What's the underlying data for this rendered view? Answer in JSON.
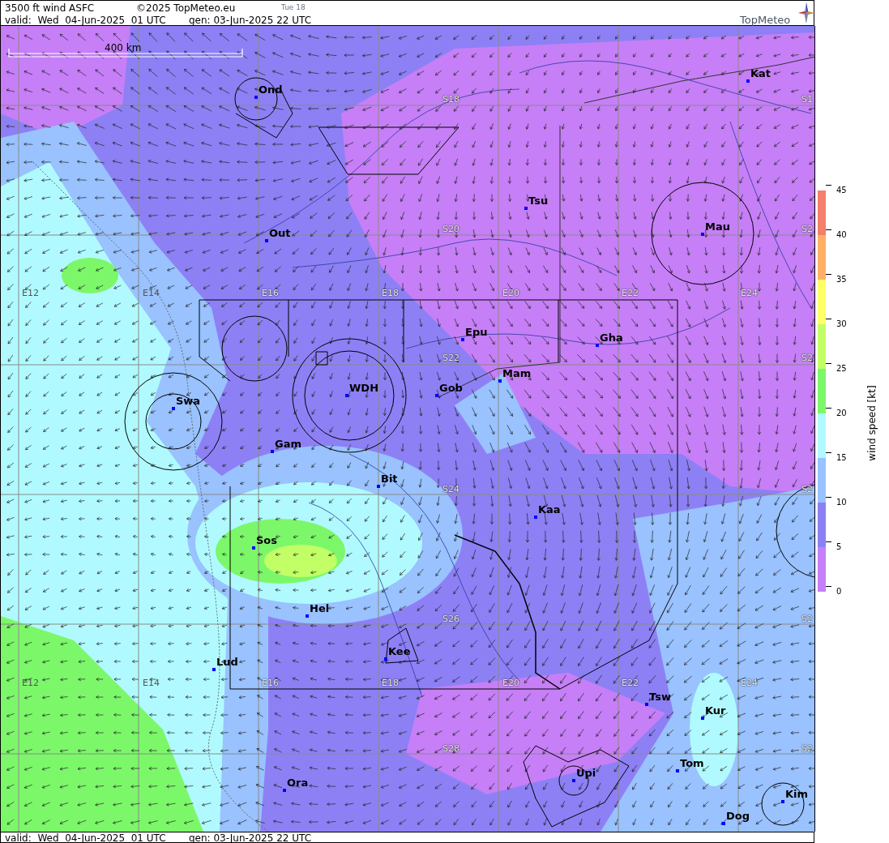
{
  "header": {
    "title": "3500 ft wind ASFC",
    "copyright": "©2025 TopMeteo.eu",
    "day_tab": "Tue 18",
    "valid": "valid:  Wed  04-Jun-2025  01 UTC",
    "generated": "gen: 03-Jun-2025 22 UTC",
    "logo": "TopMeteo"
  },
  "map": {
    "scale_label": "400 km",
    "grid_labels": [
      "S18",
      "S1",
      "S20",
      "S2",
      "E12",
      "E14",
      "E16",
      "E18",
      "E20",
      "E22",
      "E24",
      "S22",
      "S2",
      "S24",
      "S2",
      "S26",
      "S2",
      "E12",
      "E14",
      "E16",
      "E18",
      "E20",
      "E22",
      "E24",
      "S28",
      "S2"
    ],
    "places": [
      "Ond",
      "Kat",
      "Tsu",
      "Mau",
      "Out",
      "Epu",
      "Gha",
      "Mam",
      "Gob",
      "WDH",
      "Swa",
      "Gam",
      "Bit",
      "Kaa",
      "Sos",
      "Hel",
      "Kee",
      "Lud",
      "Tsw",
      "Kur",
      "Tom",
      "Upi",
      "Ora",
      "Kim",
      "Dog"
    ]
  },
  "legend": {
    "title": "wind speed [kt]",
    "ticks": [
      "45",
      "40",
      "35",
      "30",
      "25",
      "20",
      "15",
      "10",
      "5",
      "0"
    ],
    "bands": [
      {
        "color": "#f47f6b"
      },
      {
        "color": "#ffb066"
      },
      {
        "color": "#ffff66"
      },
      {
        "color": "#c2ff66"
      },
      {
        "color": "#7cf76a"
      },
      {
        "color": "#b0faff"
      },
      {
        "color": "#99c2ff"
      },
      {
        "color": "#8d80f5"
      },
      {
        "color": "#c67ff7"
      }
    ]
  },
  "footer": {
    "valid": "valid:  Wed  04-Jun-2025  01 UTC",
    "generated": "gen: 03-Jun-2025 22 UTC"
  }
}
